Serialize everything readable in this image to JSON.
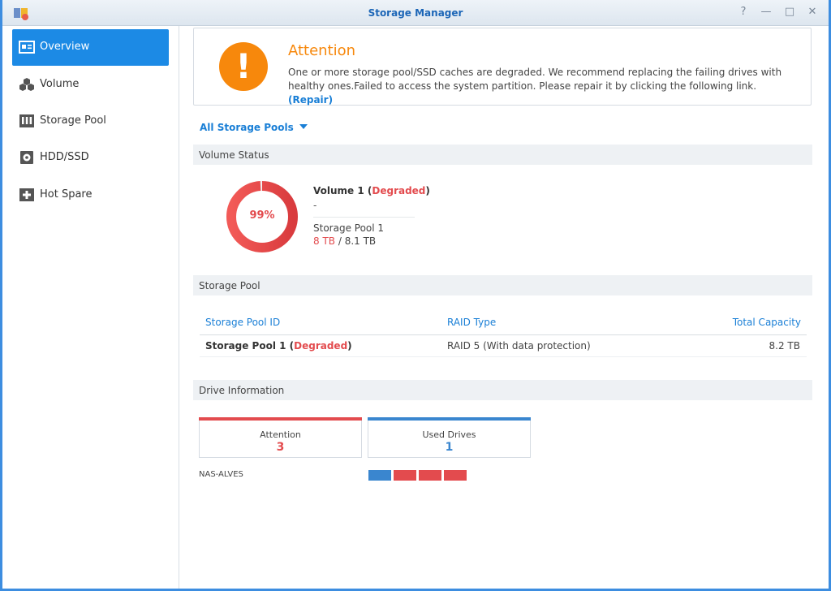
{
  "window": {
    "title": "Storage Manager",
    "help_glyph": "?",
    "minimize_glyph": "—",
    "maximize_glyph": "□",
    "close_glyph": "✕"
  },
  "sidebar": {
    "items": [
      {
        "label": "Overview",
        "icon": "overview-icon",
        "active": true
      },
      {
        "label": "Volume",
        "icon": "volume-icon",
        "active": false
      },
      {
        "label": "Storage Pool",
        "icon": "storage-pool-icon",
        "active": false
      },
      {
        "label": "HDD/SSD",
        "icon": "hdd-icon",
        "active": false
      },
      {
        "label": "Hot Spare",
        "icon": "hot-spare-icon",
        "active": false
      }
    ]
  },
  "alert": {
    "badge": "!",
    "title": "Attention",
    "message": "One or more storage pool/SSD caches are degraded. We recommend replacing the failing drives with healthy ones.Failed to access the system partition. Please repair it by clicking the following link.",
    "link": "(Repair)"
  },
  "filter": {
    "label": "All Storage Pools"
  },
  "volume_status": {
    "heading": "Volume Status",
    "usage_percent": 99,
    "usage_label": "99%",
    "name": "Volume 1",
    "paren_open": " (",
    "status": "Degraded",
    "paren_close": ")",
    "description": "-",
    "pool": "Storage Pool 1",
    "used": "8 TB",
    "total": " / 8.1 TB"
  },
  "storage_pool": {
    "heading": "Storage Pool",
    "columns": [
      "Storage Pool ID",
      "RAID Type",
      "Total Capacity"
    ],
    "rows": [
      {
        "id": "Storage Pool 1",
        "status": "Degraded",
        "raid": "RAID 5 (With data protection)",
        "capacity": "8.2 TB"
      }
    ]
  },
  "drive_info": {
    "heading": "Drive Information",
    "attention_label": "Attention",
    "attention_count": "3",
    "used_label": "Used Drives",
    "used_count": "1",
    "nas_name": "NAS-ALVES",
    "slots": [
      "normal",
      "attention",
      "attention",
      "attention"
    ]
  },
  "colors": {
    "accent": "#1c8ae5",
    "warning": "#f7880c",
    "error": "#e34b4e",
    "normal": "#3a86cf"
  }
}
